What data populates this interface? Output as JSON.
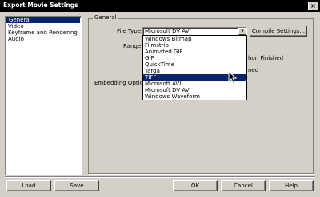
{
  "window": {
    "title": "Export Movie Settings",
    "close_glyph": "×"
  },
  "categories": {
    "items": [
      {
        "label": "General",
        "selected": true
      },
      {
        "label": "Video",
        "selected": false
      },
      {
        "label": "Keyframe and Rendering",
        "selected": false
      },
      {
        "label": "Audio",
        "selected": false
      }
    ]
  },
  "general": {
    "group_title": "General",
    "file_type_label": "File Type:",
    "file_type_value": "Microsoft DV AVI",
    "compile_button": "Compile Settings...",
    "range_label": "Range:",
    "embedding_label": "Embedding Options:",
    "partial_text_1": "hon Finished",
    "partial_text_2": "ned",
    "dropdown_options": [
      "Windows Bitmap",
      "Filmstrip",
      "Animated GIF",
      "GIF",
      "QuickTime",
      "Targa",
      "TIFF",
      "Microsoft AVI",
      "Microsoft DV AVI",
      "Windows Waveform"
    ],
    "highlighted_option": "TIFF"
  },
  "footer": {
    "load": "Load",
    "save": "Save",
    "ok": "OK",
    "cancel": "Cancel",
    "help": "Help"
  },
  "colors": {
    "selection": "#0a246a",
    "face": "#d4d0c8",
    "titlebar": "#000000"
  }
}
